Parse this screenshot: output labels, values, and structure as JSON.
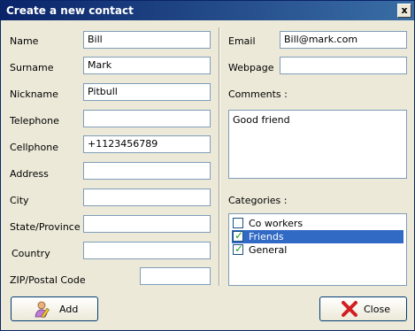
{
  "window": {
    "title": "Create a new contact",
    "close_glyph": "x"
  },
  "left": {
    "name_label": "Name",
    "name_value": "Bill",
    "surname_label": "Surname",
    "surname_value": "Mark",
    "nickname_label": "Nickname",
    "nickname_value": "Pitbull",
    "telephone_label": "Telephone",
    "telephone_value": "",
    "cellphone_label": "Cellphone",
    "cellphone_value": "+1123456789",
    "address_label": "Address",
    "address_value": "",
    "city_label": "City",
    "city_value": "",
    "state_label": "State/Province",
    "state_value": "",
    "country_label": "Country",
    "country_value": "",
    "zip_label": "ZIP/Postal Code",
    "zip_value": ""
  },
  "right": {
    "email_label": "Email",
    "email_value": "Bill@mark.com",
    "webpage_label": "Webpage",
    "webpage_value": "",
    "comments_label": "Comments :",
    "comments_value": "Good friend",
    "categories_label": "Categories :",
    "categories": [
      {
        "label": "Co workers",
        "checked": false,
        "selected": false
      },
      {
        "label": "Friends",
        "checked": true,
        "selected": true
      },
      {
        "label": "General",
        "checked": true,
        "selected": false
      }
    ]
  },
  "buttons": {
    "add_label": "Add",
    "close_label": "Close"
  },
  "colors": {
    "title_bar": "#0a246a",
    "selection": "#316ac5",
    "window_bg": "#ece9d8",
    "check": "#21a121",
    "close_icon": "#d21e1e"
  },
  "icons": {
    "add": "user-edit-icon",
    "close": "red-x-icon"
  }
}
